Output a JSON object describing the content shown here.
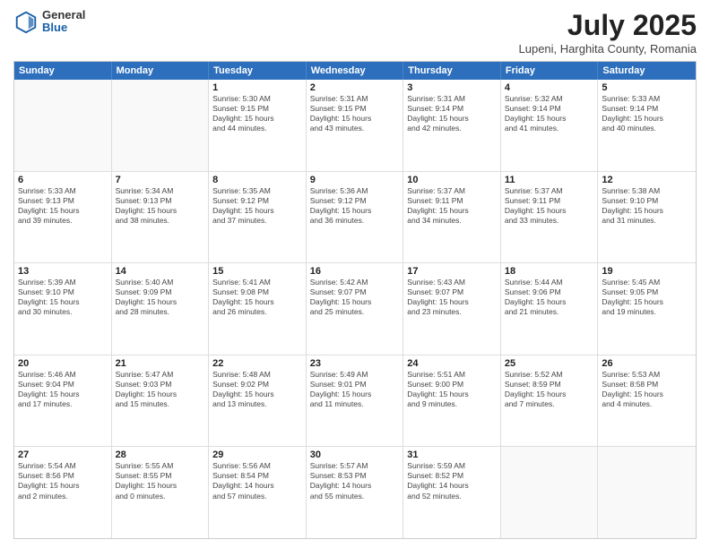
{
  "header": {
    "logo_general": "General",
    "logo_blue": "Blue",
    "month_title": "July 2025",
    "subtitle": "Lupeni, Harghita County, Romania"
  },
  "days_of_week": [
    "Sunday",
    "Monday",
    "Tuesday",
    "Wednesday",
    "Thursday",
    "Friday",
    "Saturday"
  ],
  "weeks": [
    [
      {
        "day": "",
        "details": []
      },
      {
        "day": "",
        "details": []
      },
      {
        "day": "1",
        "details": [
          "Sunrise: 5:30 AM",
          "Sunset: 9:15 PM",
          "Daylight: 15 hours",
          "and 44 minutes."
        ]
      },
      {
        "day": "2",
        "details": [
          "Sunrise: 5:31 AM",
          "Sunset: 9:15 PM",
          "Daylight: 15 hours",
          "and 43 minutes."
        ]
      },
      {
        "day": "3",
        "details": [
          "Sunrise: 5:31 AM",
          "Sunset: 9:14 PM",
          "Daylight: 15 hours",
          "and 42 minutes."
        ]
      },
      {
        "day": "4",
        "details": [
          "Sunrise: 5:32 AM",
          "Sunset: 9:14 PM",
          "Daylight: 15 hours",
          "and 41 minutes."
        ]
      },
      {
        "day": "5",
        "details": [
          "Sunrise: 5:33 AM",
          "Sunset: 9:14 PM",
          "Daylight: 15 hours",
          "and 40 minutes."
        ]
      }
    ],
    [
      {
        "day": "6",
        "details": [
          "Sunrise: 5:33 AM",
          "Sunset: 9:13 PM",
          "Daylight: 15 hours",
          "and 39 minutes."
        ]
      },
      {
        "day": "7",
        "details": [
          "Sunrise: 5:34 AM",
          "Sunset: 9:13 PM",
          "Daylight: 15 hours",
          "and 38 minutes."
        ]
      },
      {
        "day": "8",
        "details": [
          "Sunrise: 5:35 AM",
          "Sunset: 9:12 PM",
          "Daylight: 15 hours",
          "and 37 minutes."
        ]
      },
      {
        "day": "9",
        "details": [
          "Sunrise: 5:36 AM",
          "Sunset: 9:12 PM",
          "Daylight: 15 hours",
          "and 36 minutes."
        ]
      },
      {
        "day": "10",
        "details": [
          "Sunrise: 5:37 AM",
          "Sunset: 9:11 PM",
          "Daylight: 15 hours",
          "and 34 minutes."
        ]
      },
      {
        "day": "11",
        "details": [
          "Sunrise: 5:37 AM",
          "Sunset: 9:11 PM",
          "Daylight: 15 hours",
          "and 33 minutes."
        ]
      },
      {
        "day": "12",
        "details": [
          "Sunrise: 5:38 AM",
          "Sunset: 9:10 PM",
          "Daylight: 15 hours",
          "and 31 minutes."
        ]
      }
    ],
    [
      {
        "day": "13",
        "details": [
          "Sunrise: 5:39 AM",
          "Sunset: 9:10 PM",
          "Daylight: 15 hours",
          "and 30 minutes."
        ]
      },
      {
        "day": "14",
        "details": [
          "Sunrise: 5:40 AM",
          "Sunset: 9:09 PM",
          "Daylight: 15 hours",
          "and 28 minutes."
        ]
      },
      {
        "day": "15",
        "details": [
          "Sunrise: 5:41 AM",
          "Sunset: 9:08 PM",
          "Daylight: 15 hours",
          "and 26 minutes."
        ]
      },
      {
        "day": "16",
        "details": [
          "Sunrise: 5:42 AM",
          "Sunset: 9:07 PM",
          "Daylight: 15 hours",
          "and 25 minutes."
        ]
      },
      {
        "day": "17",
        "details": [
          "Sunrise: 5:43 AM",
          "Sunset: 9:07 PM",
          "Daylight: 15 hours",
          "and 23 minutes."
        ]
      },
      {
        "day": "18",
        "details": [
          "Sunrise: 5:44 AM",
          "Sunset: 9:06 PM",
          "Daylight: 15 hours",
          "and 21 minutes."
        ]
      },
      {
        "day": "19",
        "details": [
          "Sunrise: 5:45 AM",
          "Sunset: 9:05 PM",
          "Daylight: 15 hours",
          "and 19 minutes."
        ]
      }
    ],
    [
      {
        "day": "20",
        "details": [
          "Sunrise: 5:46 AM",
          "Sunset: 9:04 PM",
          "Daylight: 15 hours",
          "and 17 minutes."
        ]
      },
      {
        "day": "21",
        "details": [
          "Sunrise: 5:47 AM",
          "Sunset: 9:03 PM",
          "Daylight: 15 hours",
          "and 15 minutes."
        ]
      },
      {
        "day": "22",
        "details": [
          "Sunrise: 5:48 AM",
          "Sunset: 9:02 PM",
          "Daylight: 15 hours",
          "and 13 minutes."
        ]
      },
      {
        "day": "23",
        "details": [
          "Sunrise: 5:49 AM",
          "Sunset: 9:01 PM",
          "Daylight: 15 hours",
          "and 11 minutes."
        ]
      },
      {
        "day": "24",
        "details": [
          "Sunrise: 5:51 AM",
          "Sunset: 9:00 PM",
          "Daylight: 15 hours",
          "and 9 minutes."
        ]
      },
      {
        "day": "25",
        "details": [
          "Sunrise: 5:52 AM",
          "Sunset: 8:59 PM",
          "Daylight: 15 hours",
          "and 7 minutes."
        ]
      },
      {
        "day": "26",
        "details": [
          "Sunrise: 5:53 AM",
          "Sunset: 8:58 PM",
          "Daylight: 15 hours",
          "and 4 minutes."
        ]
      }
    ],
    [
      {
        "day": "27",
        "details": [
          "Sunrise: 5:54 AM",
          "Sunset: 8:56 PM",
          "Daylight: 15 hours",
          "and 2 minutes."
        ]
      },
      {
        "day": "28",
        "details": [
          "Sunrise: 5:55 AM",
          "Sunset: 8:55 PM",
          "Daylight: 15 hours",
          "and 0 minutes."
        ]
      },
      {
        "day": "29",
        "details": [
          "Sunrise: 5:56 AM",
          "Sunset: 8:54 PM",
          "Daylight: 14 hours",
          "and 57 minutes."
        ]
      },
      {
        "day": "30",
        "details": [
          "Sunrise: 5:57 AM",
          "Sunset: 8:53 PM",
          "Daylight: 14 hours",
          "and 55 minutes."
        ]
      },
      {
        "day": "31",
        "details": [
          "Sunrise: 5:59 AM",
          "Sunset: 8:52 PM",
          "Daylight: 14 hours",
          "and 52 minutes."
        ]
      },
      {
        "day": "",
        "details": []
      },
      {
        "day": "",
        "details": []
      }
    ]
  ]
}
